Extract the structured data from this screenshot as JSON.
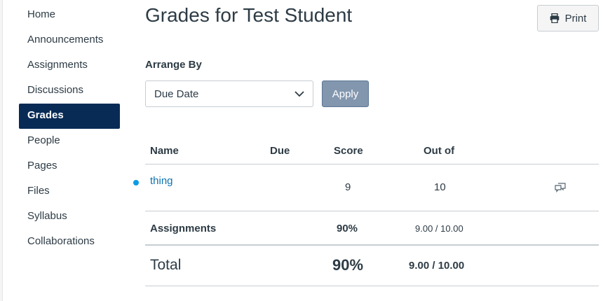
{
  "sidebar": {
    "items": [
      {
        "label": "Home",
        "active": false
      },
      {
        "label": "Announcements",
        "active": false
      },
      {
        "label": "Assignments",
        "active": false
      },
      {
        "label": "Discussions",
        "active": false
      },
      {
        "label": "Grades",
        "active": true
      },
      {
        "label": "People",
        "active": false
      },
      {
        "label": "Pages",
        "active": false
      },
      {
        "label": "Files",
        "active": false
      },
      {
        "label": "Syllabus",
        "active": false
      },
      {
        "label": "Collaborations",
        "active": false
      }
    ]
  },
  "header": {
    "title": "Grades for Test Student",
    "print_label": "Print",
    "print_icon": "printer-icon"
  },
  "arrange": {
    "label": "Arrange By",
    "selected": "Due Date",
    "apply_label": "Apply"
  },
  "table": {
    "columns": {
      "name": "Name",
      "due": "Due",
      "score": "Score",
      "out_of": "Out of"
    },
    "rows": [
      {
        "name": "thing",
        "due": "",
        "score": "9",
        "out_of": "10",
        "icon": "comment-icon",
        "unread": true
      }
    ],
    "group": {
      "name": "Assignments",
      "score": "90%",
      "out_of": "9.00 / 10.00"
    },
    "total": {
      "name": "Total",
      "score": "90%",
      "out_of": "9.00 / 10.00"
    }
  },
  "colors": {
    "active_nav_bg": "#082b56",
    "link": "#0e73ad",
    "unread_dot": "#0d9be3",
    "apply_bg": "#8296ae"
  }
}
